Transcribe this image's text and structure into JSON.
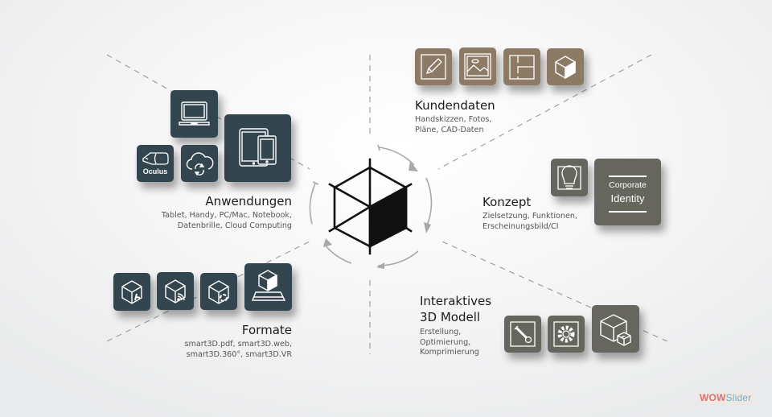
{
  "colors": {
    "slate_tile": "#33454f",
    "tan_tile": "#8d7a64",
    "olive_tile": "#66665f",
    "arrow_gray": "#a8a8a8"
  },
  "center_logo": {
    "icon": "smart3d-hexagon-cube-icon",
    "cycle": "circular-arrows-icon"
  },
  "sections": {
    "kundendaten": {
      "title": "Kundendaten",
      "desc_lines": [
        "Handskizzen, Fotos,",
        "Pläne, CAD-Daten"
      ],
      "icons": [
        "pencil-icon",
        "photo-icon",
        "floorplan-icon",
        "cube-icon"
      ]
    },
    "konzept": {
      "title": "Konzept",
      "desc_lines": [
        "Zielsetzung, Funktionen,",
        "Erscheinungsbild/CI"
      ],
      "icons": [
        "lightbulb-icon",
        "corporate-identity-icon"
      ],
      "ci_line1": "Corporate",
      "ci_line2": "Identity"
    },
    "modell": {
      "title_lines": [
        "Interaktives",
        "3D Modell"
      ],
      "desc_lines": [
        "Erstellung,",
        "Optimierung,",
        "Komprimierung"
      ],
      "icons": [
        "wrench-icon",
        "gear-icon",
        "cubes-icon"
      ]
    },
    "formate": {
      "title": "Formate",
      "desc_lines": [
        "smart3D.pdf, smart3D.web,",
        "smart3D.360°, smart3D.VR"
      ],
      "icons": [
        "cube-pdf-icon",
        "cube-web-icon",
        "cube-360-icon",
        "cube-vr-icon"
      ]
    },
    "anwendungen": {
      "title": "Anwendungen",
      "desc_lines": [
        "Tablet, Handy, PC/Mac, Notebook,",
        "Datenbrille, Cloud Computing"
      ],
      "icons": [
        "laptop-icon",
        "tablet-phone-icon",
        "oculus-icon",
        "cloud-sync-icon"
      ],
      "oculus_label": "Oculus"
    }
  },
  "watermark": {
    "part1": "WOW",
    "part2": "Slider"
  }
}
